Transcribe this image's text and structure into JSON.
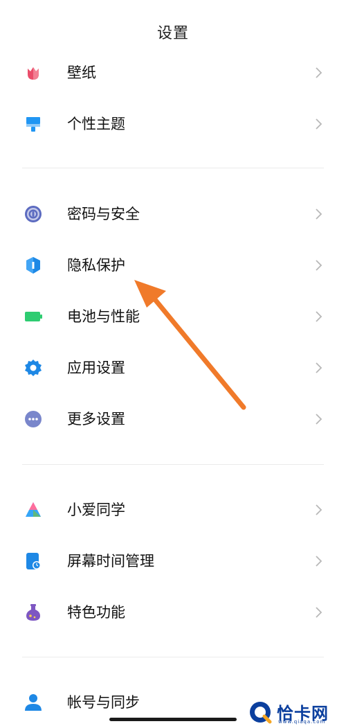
{
  "header": {
    "title": "设置"
  },
  "groups": [
    {
      "items": [
        {
          "label": "壁纸",
          "icon": "tulip-icon"
        },
        {
          "label": "个性主题",
          "icon": "paintbrush-icon"
        }
      ]
    },
    {
      "items": [
        {
          "label": "密码与安全",
          "icon": "fingerprint-icon"
        },
        {
          "label": "隐私保护",
          "icon": "privacy-shield-icon"
        },
        {
          "label": "电池与性能",
          "icon": "battery-icon"
        },
        {
          "label": "应用设置",
          "icon": "gear-icon"
        },
        {
          "label": "更多设置",
          "icon": "more-dots-icon"
        }
      ]
    },
    {
      "items": [
        {
          "label": "小爱同学",
          "icon": "xiaoai-assistant-icon"
        },
        {
          "label": "屏幕时间管理",
          "icon": "screen-time-icon"
        },
        {
          "label": "特色功能",
          "icon": "flask-icon"
        }
      ]
    },
    {
      "items": [
        {
          "label": "帐号与同步",
          "icon": "account-icon"
        }
      ]
    }
  ],
  "watermark": {
    "text": "恰卡网",
    "sub": "www.qiaqa.com"
  },
  "colors": {
    "accent_blue": "#1e88e5",
    "annotation_arrow": "#f07a2a",
    "chevron": "#b8b8b8"
  }
}
